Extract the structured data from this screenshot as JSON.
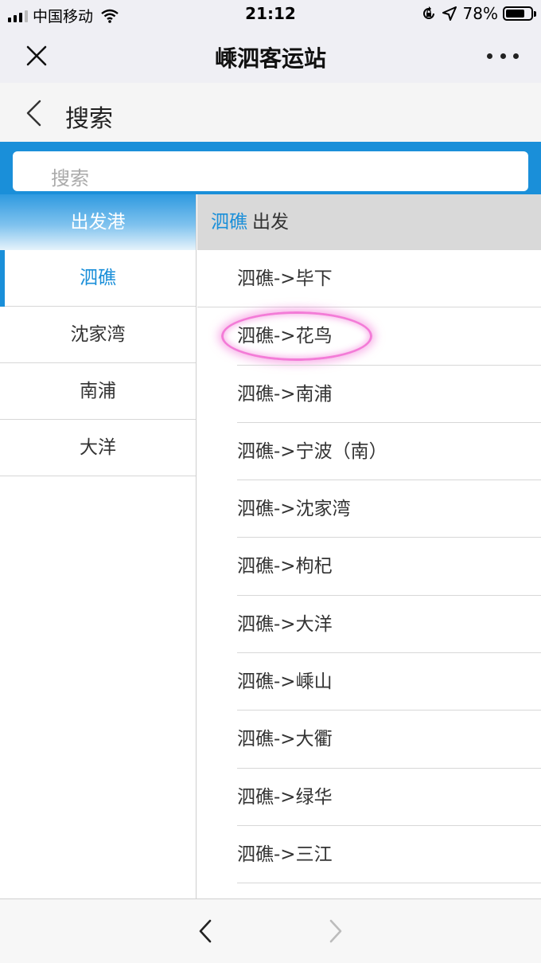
{
  "status_bar": {
    "carrier": "中国移动",
    "time": "21:12",
    "battery": "78%",
    "battery_level": 0.78,
    "icons": [
      "signal-icon",
      "wifi-icon",
      "rotation-lock-icon",
      "location-icon",
      "battery-icon"
    ]
  },
  "nav": {
    "title": "嵊泗客运站",
    "close_icon": "close-icon",
    "more_icon": "more-icon"
  },
  "page": {
    "title": "搜索",
    "back_icon": "back-icon"
  },
  "search": {
    "placeholder": "搜索"
  },
  "left": {
    "header": "出发港",
    "ports": [
      "泗礁",
      "沈家湾",
      "南浦",
      "大洋"
    ],
    "active_index": 0
  },
  "right": {
    "header_port": "泗礁",
    "header_suffix": "出发",
    "routes": [
      "泗礁->毕下",
      "泗礁->花鸟",
      "泗礁->南浦",
      "泗礁->宁波（南）",
      "泗礁->沈家湾",
      "泗礁->枸杞",
      "泗礁->大洋",
      "泗礁->嵊山",
      "泗礁->大衢",
      "泗礁->绿华",
      "泗礁->三江"
    ],
    "highlighted_index": 1
  },
  "toolbar": {
    "back_icon": "chevron-left-icon",
    "forward_icon": "chevron-right-icon"
  },
  "colors": {
    "accent": "#1a8fd9",
    "highlight": "#f37bd7"
  }
}
